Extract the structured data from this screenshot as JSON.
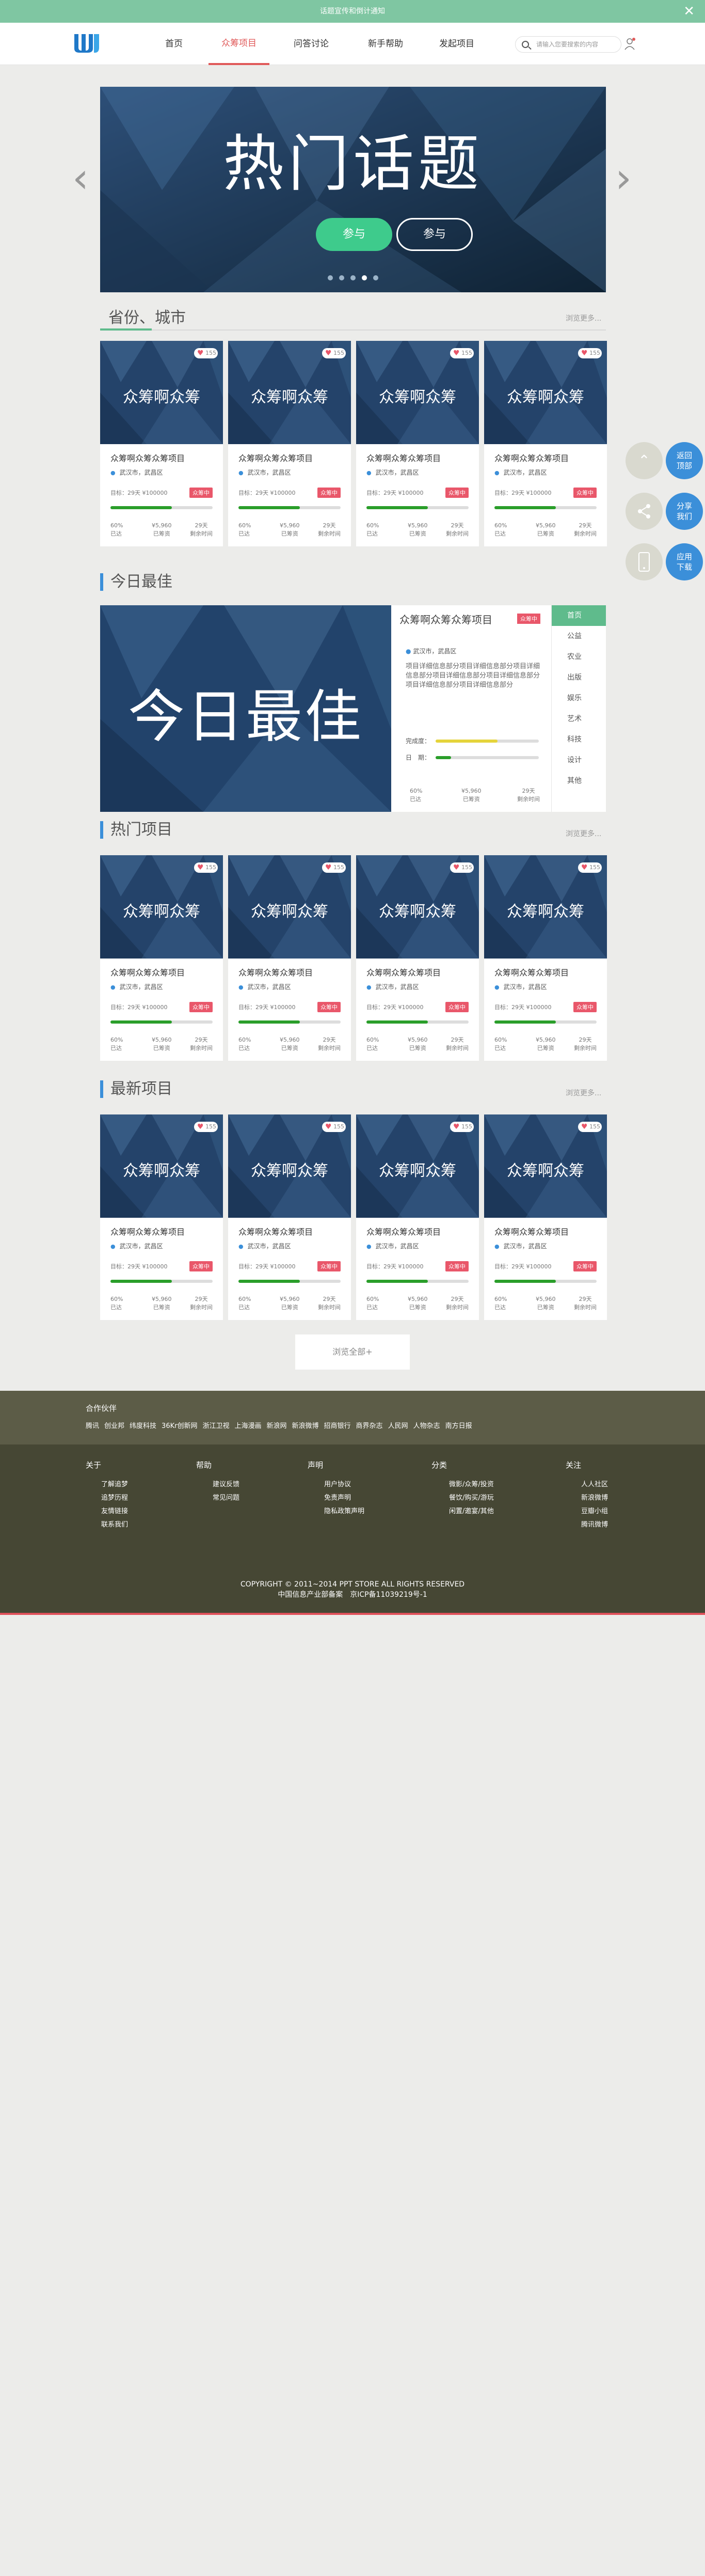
{
  "topbar": {
    "text": "话题宣传和倒计通知",
    "close": "✕"
  },
  "header": {
    "nav": [
      "首页",
      "众筹项目",
      "问答讨论",
      "新手帮助",
      "发起项目"
    ],
    "search_placeholder": "请输入您要搜索的内容"
  },
  "banner": {
    "title": "热门话题",
    "btn_primary": "参与",
    "btn_secondary": "参与",
    "slides": 5,
    "active_slide": 4
  },
  "colors": {
    "accent_green": "#3ecb8c",
    "accent_blue": "#3b8fd9",
    "badge_red": "#e9576a",
    "progress_green": "#2a9e2a",
    "progress_yellow": "#e5d43b"
  },
  "section1": {
    "title": "省份、城市",
    "more": "浏览更多..."
  },
  "section2": {
    "title": "今日最佳"
  },
  "section3": {
    "title": "热门项目",
    "more": "浏览更多..."
  },
  "section4": {
    "title": "最新项目",
    "more": "浏览更多..."
  },
  "card": {
    "likes": "155",
    "image_text": "众筹啊众筹",
    "name": "众筹啊众筹众筹项目",
    "location": "武汉市，武昌区",
    "target": "目标：29天 ¥100000",
    "badge": "众筹中",
    "pct": "60%",
    "pct_label": "已达",
    "raised": "¥5,960",
    "raised_label": "已筹资",
    "days": "29天",
    "days_label": "剩余时间",
    "progress": 0.6
  },
  "best": {
    "image_text": "今日最佳",
    "name": "众筹啊众筹众筹项目",
    "badge": "众筹中",
    "location": "武汉市，武昌区",
    "desc": "项目详细信息部分项目详细信息部分项目详细信息部分项目详细信息部分项目详细信息部分项目详细信息部分项目详细信息部分",
    "bar1_label": "完成度：",
    "bar1_value": 0.6,
    "bar2_label": "日　期：",
    "bar2_value": 0.15,
    "pct": "60%",
    "pct_label": "已达",
    "raised": "¥5,960",
    "raised_label": "已筹资",
    "days": "29天",
    "days_label": "剩余时间",
    "categories": [
      "首页",
      "公益",
      "农业",
      "出版",
      "娱乐",
      "艺术",
      "科技",
      "设计",
      "其他"
    ]
  },
  "side": {
    "top": "返回顶部",
    "share": "分享我们",
    "app": "应用下载"
  },
  "more_all": "浏览全部+",
  "partners": {
    "title": "合作伙伴",
    "links": [
      "腾讯",
      "创业邦",
      "纬度科技",
      "36Kr创新网",
      "浙江卫视",
      "上海漫画",
      "新浪网",
      "新浪微博",
      "招商银行",
      "商界杂志",
      "人民网",
      "人物杂志",
      "南方日报"
    ]
  },
  "footer": {
    "cols": [
      {
        "title": "关于",
        "items": [
          "了解追梦",
          "追梦历程",
          "友情链接",
          "联系我们"
        ]
      },
      {
        "title": "帮助",
        "items": [
          "建议反馈",
          "常见问题"
        ]
      },
      {
        "title": "声明",
        "items": [
          "用户协议",
          "免责声明",
          "隐私政策声明"
        ]
      },
      {
        "title": "分类",
        "items": [
          "微影/众筹/投资",
          "餐饮/购买/游玩",
          "闲置/邀宴/其他"
        ]
      },
      {
        "title": "关注",
        "items": [
          "人人社区",
          "新浪微博",
          "豆瓣小组",
          "腾讯微博"
        ]
      }
    ],
    "copyright": "COPYRIGHT © 2011~2014 PPT STORE ALL RIGHTS RESERVED",
    "icp": "中国信息产业部备案　京ICP备11039219号-1"
  }
}
